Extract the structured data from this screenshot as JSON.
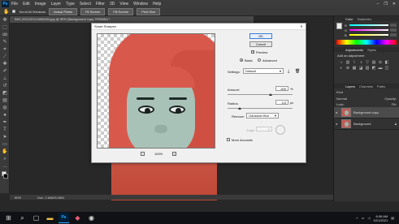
{
  "menubar": {
    "app_logo": "Ps",
    "items": [
      "File",
      "Edit",
      "Image",
      "Layer",
      "Type",
      "Select",
      "Filter",
      "3D",
      "View",
      "Window",
      "Help"
    ],
    "window_controls": [
      "–",
      "❐",
      "✕"
    ]
  },
  "optionsbar": {
    "scroll_all_windows": "Scroll All Windows",
    "buttons": [
      "Actual Pixels",
      "Fit Screen",
      "Fill Screen",
      "Print Size"
    ]
  },
  "document": {
    "tab_title": "IMG-20210219-WA0004.jpg @ 50% (Background copy, RGB/8#) *",
    "zoom": "50%",
    "doc_size": "Doc: 2.64M/5.28M"
  },
  "dialog": {
    "title": "Smart Sharpen",
    "close": "✕",
    "ok_label": "OK",
    "cancel_label": "Cancel",
    "preview_label": "Preview",
    "preview_checked": true,
    "mode_basic": "Basic",
    "mode_advanced": "Advanced",
    "mode_selected": "Basic",
    "settings_label": "Settings:",
    "settings_value": "Default",
    "amount_label": "Amount:",
    "amount_value": "200",
    "amount_unit": "%",
    "radius_label": "Radius:",
    "radius_value": "3.0",
    "radius_unit": "px",
    "remove_label": "Remove:",
    "remove_value": "Gaussian Blur",
    "angle_label": "Angle:",
    "angle_value": "0",
    "more_accurate_label": "More Accurate",
    "more_accurate_checked": false,
    "preview_zoom": "100%",
    "zoom_out": "−",
    "zoom_in": "+"
  },
  "panels": {
    "color_tabs": [
      "Color",
      "Swatches"
    ],
    "sliders": [
      {
        "label": "R",
        "value": ""
      },
      {
        "label": "G",
        "value": ""
      },
      {
        "label": "B",
        "value": ""
      }
    ],
    "adjust_tabs": [
      "Adjustments",
      "Styles"
    ],
    "add_adjustment": "Add an adjustment",
    "layers_tabs": [
      "Layers",
      "Channels",
      "Paths"
    ],
    "kind_label": "Kind",
    "blend_mode": "Normal",
    "opacity_label": "Opacity:",
    "lock_label": "Lock:",
    "fill_label": "Fill:",
    "layers": [
      {
        "name": "Background copy",
        "selected": true
      },
      {
        "name": "Background",
        "selected": false
      }
    ]
  },
  "taskbar": {
    "time": "6:08 AM",
    "date": "3/21/2021"
  },
  "colors": {
    "hijab": "#d8594c",
    "face": "#a9c2b7",
    "ps_blue": "#31a8ff",
    "ok_border": "#3b7dd8"
  }
}
